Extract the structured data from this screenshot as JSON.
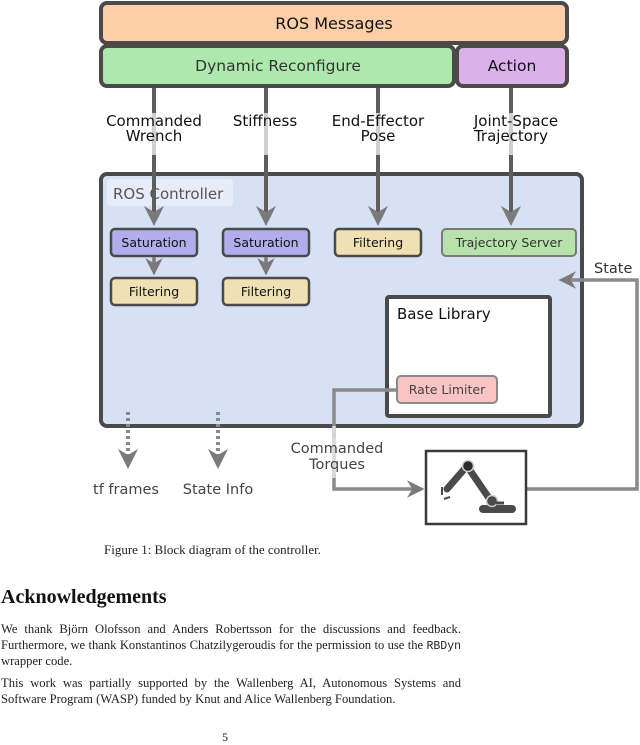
{
  "diagram": {
    "ros_messages": "ROS Messages",
    "dynamic_reconfigure": "Dynamic Reconfigure",
    "action": "Action",
    "inputs": {
      "commanded_wrench": [
        "Commanded",
        "Wrench"
      ],
      "stiffness": [
        "Stiffness"
      ],
      "end_effector_pose": [
        "End-Effector",
        "Pose"
      ],
      "joint_space_trajectory": [
        "Joint-Space",
        "Trajectory"
      ]
    },
    "ros_controller": "ROS Controller",
    "saturation_1": "Saturation",
    "saturation_2": "Saturation",
    "filtering_1": "Filtering",
    "filtering_2": "Filtering",
    "filtering_3": "Filtering",
    "trajectory_server": "Trajectory Server",
    "base_library": "Base Library",
    "rate_limiter": "Rate Limiter",
    "state": "State",
    "commanded_torques": [
      "Commanded",
      "Torques"
    ],
    "tf_frames": "tf frames",
    "state_info": "State Info",
    "robot_icon": "robot-arm-icon",
    "colors": {
      "ros_messages": "#fdcfa8",
      "dynamic_reconfigure": "#ade8ad",
      "action": "#dcb0e8",
      "controller_bg": "#d6e1f3",
      "saturation": "#b0aeec",
      "filtering": "#efe1b3",
      "trajectory_server": "#b8e2ab",
      "rate_limiter": "#fbc4c4",
      "border": "#4a4a4a",
      "arrow": "#6a6a6a"
    }
  },
  "caption": "Figure 1:  Block diagram of the controller.",
  "section_heading": "Acknowledgements",
  "paragraph1": {
    "before_code": "We thank Björn Olofsson and Anders Robertsson for the discussions and feedback. Furthermore, we thank Konstantinos Chatzilygeroudis for the permission to use the ",
    "code": "RBDyn",
    "after_code": " wrapper code."
  },
  "paragraph2": "This work was partially supported by the Wallenberg AI, Autonomous Systems and Software Program (WASP) funded by Knut and Alice Wallenberg Foundation.",
  "page_number": "5"
}
